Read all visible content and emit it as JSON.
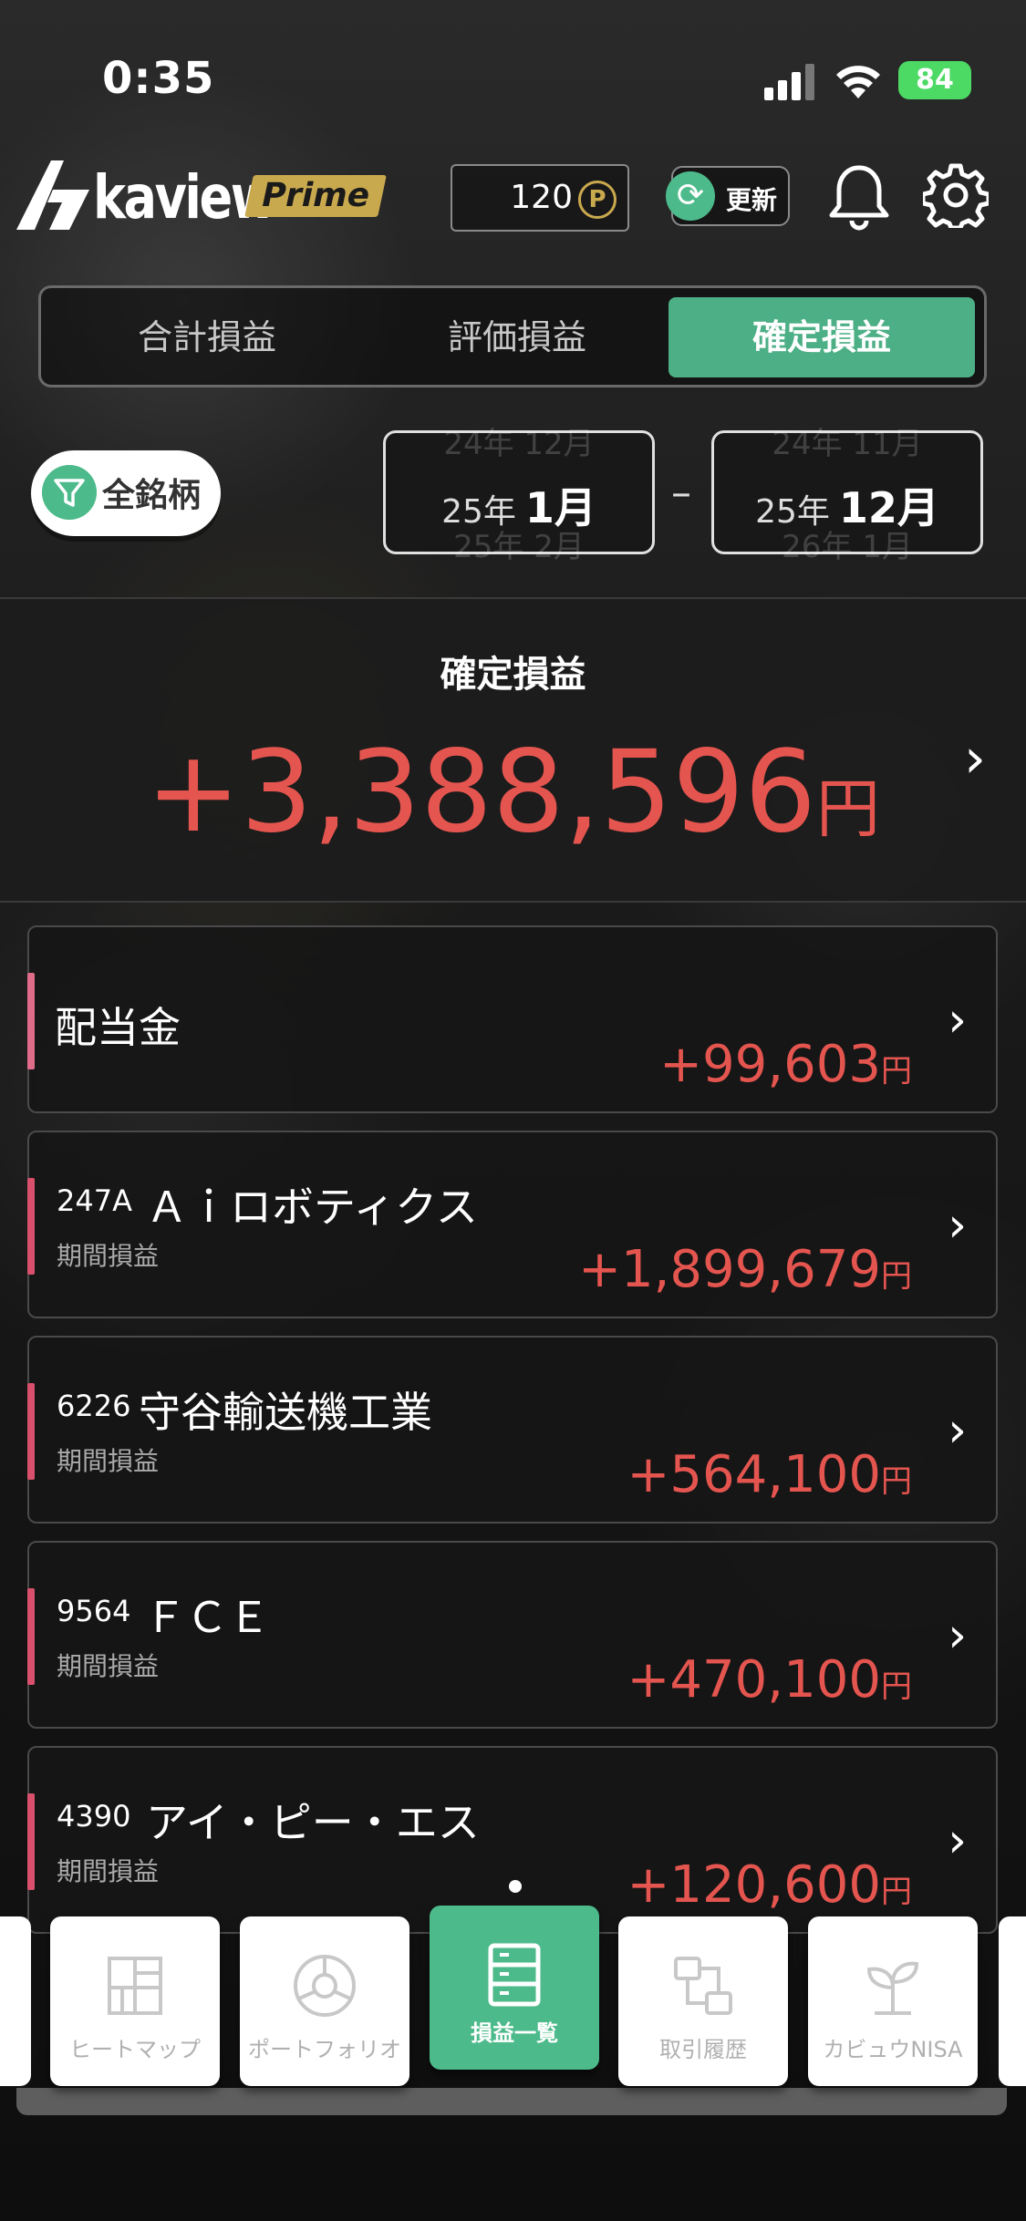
{
  "status_bar": {
    "time": "0:35",
    "battery": "84"
  },
  "header": {
    "logo_text": "kaview",
    "logo_badge": "Prime",
    "points": "120",
    "points_icon": "P",
    "refresh_label": "更新"
  },
  "tabs": [
    {
      "label": "合計損益",
      "active": false
    },
    {
      "label": "評価損益",
      "active": false
    },
    {
      "label": "確定損益",
      "active": true
    }
  ],
  "filter": {
    "label": "全銘柄"
  },
  "date_range": {
    "start": {
      "year": "25年",
      "month": "1月",
      "ghost_prev": "24年 12月",
      "ghost_next": "25年 2月"
    },
    "end": {
      "year": "25年",
      "month": "12月",
      "ghost_prev": "24年 11月",
      "ghost_next": "26年 1月"
    },
    "separator": "–"
  },
  "summary": {
    "title": "確定損益",
    "amount": "+3,388,596",
    "unit": "円"
  },
  "items": [
    {
      "code": "",
      "name": "配当金",
      "sub": "",
      "value": "+99,603",
      "unit": "円"
    },
    {
      "code": "247A",
      "name": "Ａｉロボティクス",
      "sub": "期間損益",
      "value": "+1,899,679",
      "unit": "円"
    },
    {
      "code": "6226",
      "name": "守谷輸送機工業",
      "sub": "期間損益",
      "value": "+564,100",
      "unit": "円"
    },
    {
      "code": "9564",
      "name": "ＦＣＥ",
      "sub": "期間損益",
      "value": "+470,100",
      "unit": "円"
    },
    {
      "code": "4390",
      "name": "アイ・ピー・エス",
      "sub": "期間損益",
      "value": "+120,600",
      "unit": "円"
    }
  ],
  "tabbar": [
    {
      "label": "ヒートマップ",
      "icon": "heatmap-icon",
      "active": false
    },
    {
      "label": "ポートフォリオ",
      "icon": "portfolio-icon",
      "active": false
    },
    {
      "label": "損益一覧",
      "icon": "profit-list-icon",
      "active": true
    },
    {
      "label": "取引履歴",
      "icon": "trade-history-icon",
      "active": false
    },
    {
      "label": "カビュウNISA",
      "icon": "nisa-icon",
      "active": false
    }
  ],
  "colors": {
    "accent": "#4caf85",
    "profit": "#e5554f",
    "gold": "#c9a94e"
  }
}
